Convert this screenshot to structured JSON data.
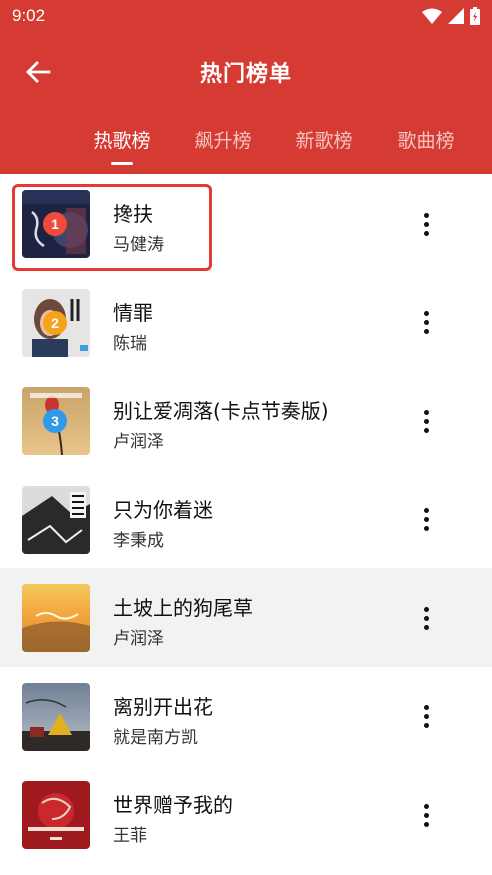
{
  "status_bar": {
    "time": "9:02"
  },
  "app_bar": {
    "title": "热门榜单"
  },
  "tabs": [
    {
      "label": "热歌榜",
      "active": true
    },
    {
      "label": "飙升榜",
      "active": false
    },
    {
      "label": "新歌榜",
      "active": false
    },
    {
      "label": "歌曲榜",
      "active": false
    }
  ],
  "songs": [
    {
      "rank": "1",
      "title": "搀扶",
      "artist": "马健涛"
    },
    {
      "rank": "2",
      "title": "情罪",
      "artist": "陈瑞"
    },
    {
      "rank": "3",
      "title": "别让爱凋落(卡点节奏版)",
      "artist": "卢润泽"
    },
    {
      "title": "只为你着迷",
      "artist": "李秉成"
    },
    {
      "title": "土坡上的狗尾草",
      "artist": "卢润泽"
    },
    {
      "title": "离别开出花",
      "artist": "就是南方凯"
    },
    {
      "title": "世界赠予我的",
      "artist": "王菲"
    }
  ],
  "colors": {
    "header": "#d63b33",
    "rank1": "#f04a3c",
    "rank2": "#f5a31a",
    "rank3": "#2f9be8",
    "selection": "#e53935"
  },
  "icons": {
    "back": "arrow-left-icon",
    "more": "more-vertical-icon",
    "wifi": "wifi-icon",
    "signal": "signal-icon",
    "battery": "battery-icon"
  }
}
